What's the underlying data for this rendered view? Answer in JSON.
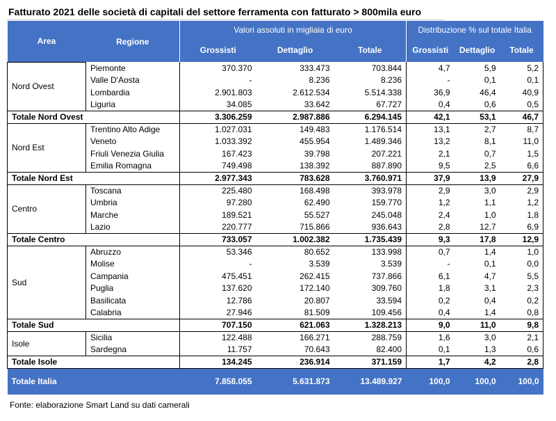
{
  "title": "Fatturato 2021 delle società di capitali del settore ferramenta con fatturato > 800mila euro",
  "header": {
    "area": "Area",
    "regione": "Regione",
    "group_abs": "Valori assoluti in migliaia di euro",
    "group_pct": "Distribuzione % sul totale Italia",
    "grossisti": "Grossisti",
    "dettaglio": "Dettaglio",
    "totale": "Totale"
  },
  "groups": [
    {
      "area": "Nord Ovest",
      "rows": [
        {
          "regione": "Piemonte",
          "g": "370.370",
          "d": "333.473",
          "t": "703.844",
          "pg": "4,7",
          "pd": "5,9",
          "pt": "5,2"
        },
        {
          "regione": "Valle D'Aosta",
          "g": "-",
          "d": "8.236",
          "t": "8.236",
          "pg": "-",
          "pd": "0,1",
          "pt": "0,1"
        },
        {
          "regione": "Lombardia",
          "g": "2.901.803",
          "d": "2.612.534",
          "t": "5.514.338",
          "pg": "36,9",
          "pd": "46,4",
          "pt": "40,9"
        },
        {
          "regione": "Liguria",
          "g": "34.085",
          "d": "33.642",
          "t": "67.727",
          "pg": "0,4",
          "pd": "0,6",
          "pt": "0,5"
        }
      ],
      "total": {
        "label": "Totale Nord Ovest",
        "g": "3.306.259",
        "d": "2.987.886",
        "t": "6.294.145",
        "pg": "42,1",
        "pd": "53,1",
        "pt": "46,7"
      }
    },
    {
      "area": "Nord Est",
      "rows": [
        {
          "regione": "Trentino Alto Adige",
          "g": "1.027.031",
          "d": "149.483",
          "t": "1.176.514",
          "pg": "13,1",
          "pd": "2,7",
          "pt": "8,7"
        },
        {
          "regione": "Veneto",
          "g": "1.033.392",
          "d": "455.954",
          "t": "1.489.346",
          "pg": "13,2",
          "pd": "8,1",
          "pt": "11,0"
        },
        {
          "regione": "Friuli Venezia Giulia",
          "g": "167.423",
          "d": "39.798",
          "t": "207.221",
          "pg": "2,1",
          "pd": "0,7",
          "pt": "1,5"
        },
        {
          "regione": "Emilia Romagna",
          "g": "749.498",
          "d": "138.392",
          "t": "887.890",
          "pg": "9,5",
          "pd": "2,5",
          "pt": "6,6"
        }
      ],
      "total": {
        "label": "Totale Nord Est",
        "g": "2.977.343",
        "d": "783.628",
        "t": "3.760.971",
        "pg": "37,9",
        "pd": "13,9",
        "pt": "27,9"
      }
    },
    {
      "area": "Centro",
      "rows": [
        {
          "regione": "Toscana",
          "g": "225.480",
          "d": "168.498",
          "t": "393.978",
          "pg": "2,9",
          "pd": "3,0",
          "pt": "2,9"
        },
        {
          "regione": "Umbria",
          "g": "97.280",
          "d": "62.490",
          "t": "159.770",
          "pg": "1,2",
          "pd": "1,1",
          "pt": "1,2"
        },
        {
          "regione": "Marche",
          "g": "189.521",
          "d": "55.527",
          "t": "245.048",
          "pg": "2,4",
          "pd": "1,0",
          "pt": "1,8"
        },
        {
          "regione": "Lazio",
          "g": "220.777",
          "d": "715.866",
          "t": "936.643",
          "pg": "2,8",
          "pd": "12,7",
          "pt": "6,9"
        }
      ],
      "total": {
        "label": "Totale Centro",
        "g": "733.057",
        "d": "1.002.382",
        "t": "1.735.439",
        "pg": "9,3",
        "pd": "17,8",
        "pt": "12,9"
      }
    },
    {
      "area": "Sud",
      "rows": [
        {
          "regione": "Abruzzo",
          "g": "53.346",
          "d": "80.652",
          "t": "133.998",
          "pg": "0,7",
          "pd": "1,4",
          "pt": "1,0"
        },
        {
          "regione": "Molise",
          "g": "-",
          "d": "3.539",
          "t": "3.539",
          "pg": "-",
          "pd": "0,1",
          "pt": "0,0"
        },
        {
          "regione": "Campania",
          "g": "475.451",
          "d": "262.415",
          "t": "737.866",
          "pg": "6,1",
          "pd": "4,7",
          "pt": "5,5"
        },
        {
          "regione": "Puglia",
          "g": "137.620",
          "d": "172.140",
          "t": "309.760",
          "pg": "1,8",
          "pd": "3,1",
          "pt": "2,3"
        },
        {
          "regione": "Basilicata",
          "g": "12.786",
          "d": "20.807",
          "t": "33.594",
          "pg": "0,2",
          "pd": "0,4",
          "pt": "0,2"
        },
        {
          "regione": "Calabria",
          "g": "27.946",
          "d": "81.509",
          "t": "109.456",
          "pg": "0,4",
          "pd": "1,4",
          "pt": "0,8"
        }
      ],
      "total": {
        "label": "Totale Sud",
        "g": "707.150",
        "d": "621.063",
        "t": "1.328.213",
        "pg": "9,0",
        "pd": "11,0",
        "pt": "9,8"
      }
    },
    {
      "area": "Isole",
      "rows": [
        {
          "regione": "Sicilia",
          "g": "122.488",
          "d": "166.271",
          "t": "288.759",
          "pg": "1,6",
          "pd": "3,0",
          "pt": "2,1"
        },
        {
          "regione": "Sardegna",
          "g": "11.757",
          "d": "70.643",
          "t": "82.400",
          "pg": "0,1",
          "pd": "1,3",
          "pt": "0,6"
        }
      ],
      "total": {
        "label": "Totale Isole",
        "g": "134.245",
        "d": "236.914",
        "t": "371.159",
        "pg": "1,7",
        "pd": "4,2",
        "pt": "2,8"
      }
    }
  ],
  "italia": {
    "label": "Totale Italia",
    "g": "7.858.055",
    "d": "5.631.873",
    "t": "13.489.927",
    "pg": "100,0",
    "pd": "100,0",
    "pt": "100,0"
  },
  "footer": "Fonte: elaborazione Smart Land su dati camerali",
  "colors": {
    "header_bg": "#4472c4",
    "header_text": "#ffffff",
    "border": "#000000"
  }
}
